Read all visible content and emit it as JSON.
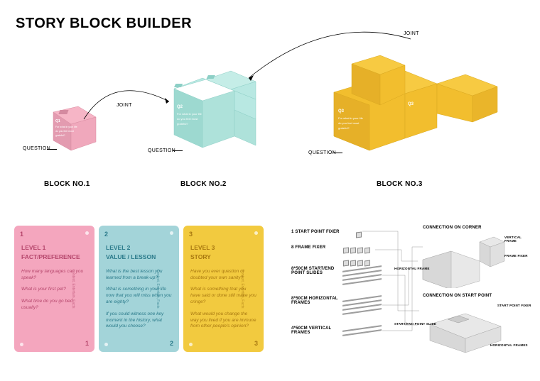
{
  "title": "STORY BLOCK BUILDER",
  "top": {
    "joint_label": "JOINT",
    "question_label": "QUESTION",
    "blocks": [
      {
        "caption": "BLOCK NO.1",
        "q_tag": "Q1",
        "face_lines": [
          "For what in your life",
          "do you feel most",
          "grateful?"
        ]
      },
      {
        "caption": "BLOCK NO.2",
        "q_tag": "Q2",
        "face_lines": [
          "For what in your life",
          "do you feel most",
          "grateful?"
        ]
      },
      {
        "caption": "BLOCK NO.3",
        "q_tag": "Q3",
        "face_lines": [
          "For what in your life",
          "do you feel most",
          "grateful?"
        ]
      }
    ]
  },
  "cards": [
    {
      "num": "1",
      "level": "LEVEL 1",
      "sub": "FACT/PREFERENCE",
      "side": "Context, Entertain, Facts",
      "qs": [
        "How many languages can you speak?",
        "What is your first pet?",
        "What time do you go bed usually?"
      ]
    },
    {
      "num": "2",
      "level": "LEVEL 2",
      "sub": "VALUE / LESSON",
      "side": "Context, Entertain, Facts",
      "qs": [
        "What is the best lesson you learned from a break-up?",
        "What is something in your life now that you will miss when you are eighty?",
        "If you could witness one key moment in the history, what would you choose?"
      ]
    },
    {
      "num": "3",
      "level": "LEVEL 3",
      "sub": "STORY",
      "side": "Context, Entertain, Facts",
      "qs": [
        "Have you ever question or doubted your own sanity?",
        "What is something that you have said or done still make you cringe?",
        "What would you change the way you lived if you are immune from other people's opinion?"
      ]
    }
  ],
  "diagram": {
    "labels": {
      "start_fixer": "1 START POINT FIXER",
      "frame_fixer": "8 FRAME FIXER",
      "start_end_slides": "8*50CM START/END POINT SLIDES",
      "horizontal_frames": "8*50CM HORIZONTAL FRAMES",
      "vertical_frames": "4*50CM VERTICAL FRAMES",
      "connection_corner": "CONNECTION ON CORNER",
      "connection_start": "CONNECTION ON START POINT",
      "vertical_frame": "VERTICAL FRAME",
      "horizontal_frame": "HORIZONTAL FRAME",
      "frame_fixer_small": "FRAME FIXER",
      "start_point_fixer": "START POINT FIXER",
      "start_end_point_slide": "START/END POINT SLIDE",
      "horizontal_frames_small": "HORIZONTAL FRAMES"
    }
  }
}
